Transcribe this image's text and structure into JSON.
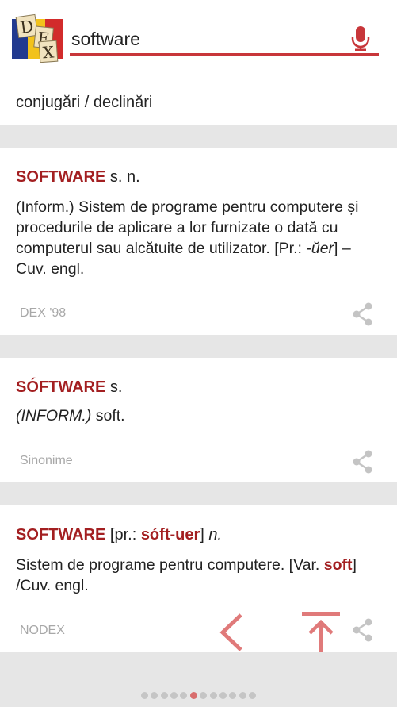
{
  "search": {
    "value": "software",
    "placeholder": ""
  },
  "logo": {
    "letters": [
      "D",
      "E",
      "X"
    ]
  },
  "conjugation_link": "conjugări / declinări",
  "definitions": [
    {
      "word": "SOFTWARE",
      "grammar": "s. n.",
      "text_parts": [
        "(Inform.) Sistem de programe pentru computere și procedurile de aplicare a lor furnizate o dată cu computerul sau alcătuite de utilizator. [Pr.: ",
        "-ŭer",
        "] – Cuv. engl."
      ],
      "source": "DEX '98"
    },
    {
      "word": "SÓFTWARE",
      "grammar": "s.",
      "text_parts": [
        "(INFORM.)",
        " soft."
      ],
      "source": "Sinonime"
    },
    {
      "word": "SOFTWARE",
      "pron_open": "[pr.: ",
      "pron": "sóft-uer",
      "pron_close": "]",
      "grammar": "n.",
      "text_parts": [
        "Sistem de programe pentru computere. [Var. ",
        "soft",
        "] /Cuv. engl."
      ],
      "source": "NODEX"
    }
  ],
  "pagination": {
    "total": 12,
    "active_index": 5
  },
  "colors": {
    "accent": "#a31f21",
    "underline": "#c8363a",
    "separator": "#e6e6e6",
    "source_text": "#a8a8a8",
    "icon_gray": "#c4c4c4",
    "overlay_red": "#e07a7a",
    "logo_blue": "#223a8f",
    "logo_yellow": "#f2c21b",
    "logo_red": "#d22b2b"
  },
  "icons": {
    "microphone": "microphone-icon",
    "share": "share-icon",
    "back": "chevron-left-icon",
    "top": "scroll-to-top-icon"
  }
}
